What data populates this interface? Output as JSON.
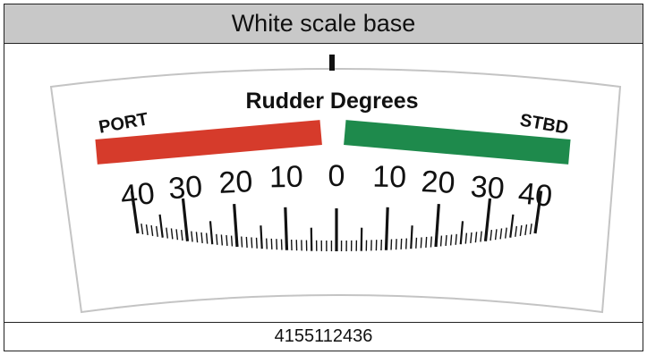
{
  "title": "White scale base",
  "part_number": "4155112436",
  "scale": {
    "heading": "Rudder Degrees",
    "port_label": "PORT",
    "stbd_label": "STBD",
    "port_color": "#d63b2b",
    "stbd_color": "#1e8a4c",
    "port_ticks": [
      "40",
      "30",
      "20",
      "10"
    ],
    "center_tick": "0",
    "stbd_ticks": [
      "10",
      "20",
      "30",
      "40"
    ]
  }
}
